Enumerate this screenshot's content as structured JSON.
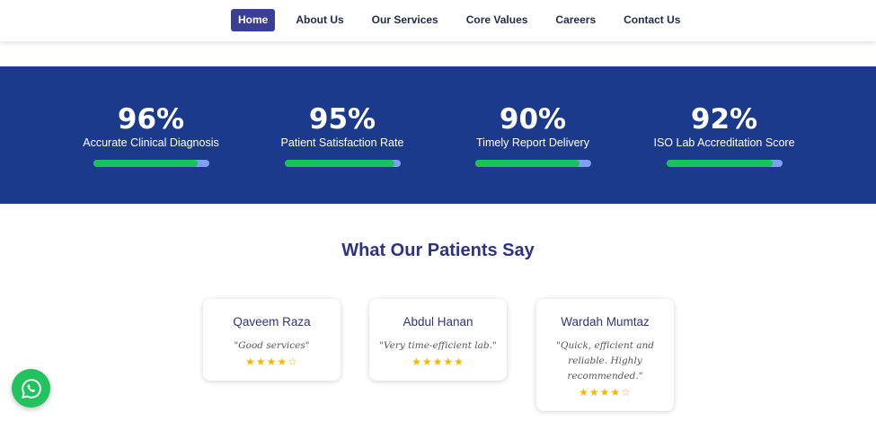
{
  "nav": {
    "items": [
      {
        "label": "Home",
        "active": true
      },
      {
        "label": "About Us"
      },
      {
        "label": "Our Services"
      },
      {
        "label": "Core Values"
      },
      {
        "label": "Careers"
      },
      {
        "label": "Contact Us"
      }
    ]
  },
  "stats": {
    "background": "#1c3a8c",
    "bar_fill_color": "#19c35a",
    "bar_track_color": "#7fa0f5",
    "items": [
      {
        "value": "96%",
        "label": "Accurate Clinical Diagnosis",
        "progress": 0.9
      },
      {
        "value": "95%",
        "label": "Patient Satisfaction Rate",
        "progress": 0.95
      },
      {
        "value": "90%",
        "label": "Timely Report Delivery",
        "progress": 0.9
      },
      {
        "value": "92%",
        "label": "ISO Lab Accreditation Score",
        "progress": 0.92
      }
    ]
  },
  "testimonials": {
    "title": "What Our Patients Say",
    "cards": [
      {
        "name": "Qaveem Raza",
        "quote": "\"Good services\"",
        "rating": 4,
        "max_rating": 5
      },
      {
        "name": "Abdul Hanan",
        "quote": "\"Very time-efficient lab.\"",
        "rating": 5,
        "max_rating": 5
      },
      {
        "name": "Wardah Mumtaz",
        "quote": "\"Quick, efficient and reliable. Highly recommended.\"",
        "rating": 4,
        "max_rating": 5
      }
    ]
  },
  "whatsapp": {
    "icon": "whatsapp-icon",
    "color": "#22c35e"
  }
}
